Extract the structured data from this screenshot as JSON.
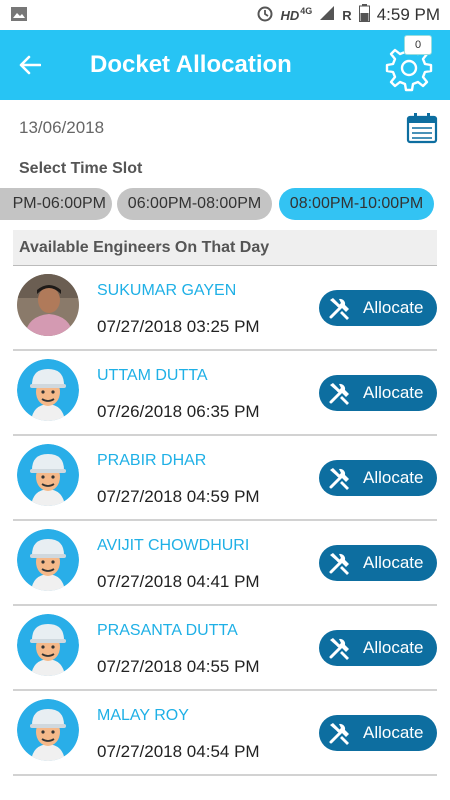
{
  "status_bar": {
    "hd": "HD",
    "network": "4G",
    "roaming": "R",
    "time": "4:59 PM"
  },
  "header": {
    "title": "Docket Allocation",
    "notification_count": "0"
  },
  "date": "13/06/2018",
  "time_slot": {
    "label": "Select Time Slot",
    "slots": [
      "PM-06:00PM",
      "06:00PM-08:00PM",
      "08:00PM-10:00PM"
    ],
    "selected_index": 2
  },
  "engineers": {
    "heading": "Available Engineers On That Day",
    "allocate_label": "Allocate",
    "items": [
      {
        "name": "SUKUMAR GAYEN",
        "datetime": "07/27/2018 03:25 PM",
        "avatar": "photo"
      },
      {
        "name": "UTTAM DUTTA",
        "datetime": "07/26/2018 06:35 PM",
        "avatar": "engineer"
      },
      {
        "name": "PRABIR DHAR",
        "datetime": "07/27/2018 04:59 PM",
        "avatar": "engineer"
      },
      {
        "name": "AVIJIT CHOWDHURI",
        "datetime": "07/27/2018 04:41 PM",
        "avatar": "engineer"
      },
      {
        "name": "PRASANTA DUTTA",
        "datetime": "07/27/2018 04:55 PM",
        "avatar": "engineer"
      },
      {
        "name": "MALAY ROY",
        "datetime": "07/27/2018 04:54 PM",
        "avatar": "engineer"
      }
    ]
  },
  "colors": {
    "app_bar": "#27c4f4",
    "selected_slot": "#33c3f3",
    "allocate_button": "#0d6ea0",
    "name_text": "#1fb0e6"
  }
}
